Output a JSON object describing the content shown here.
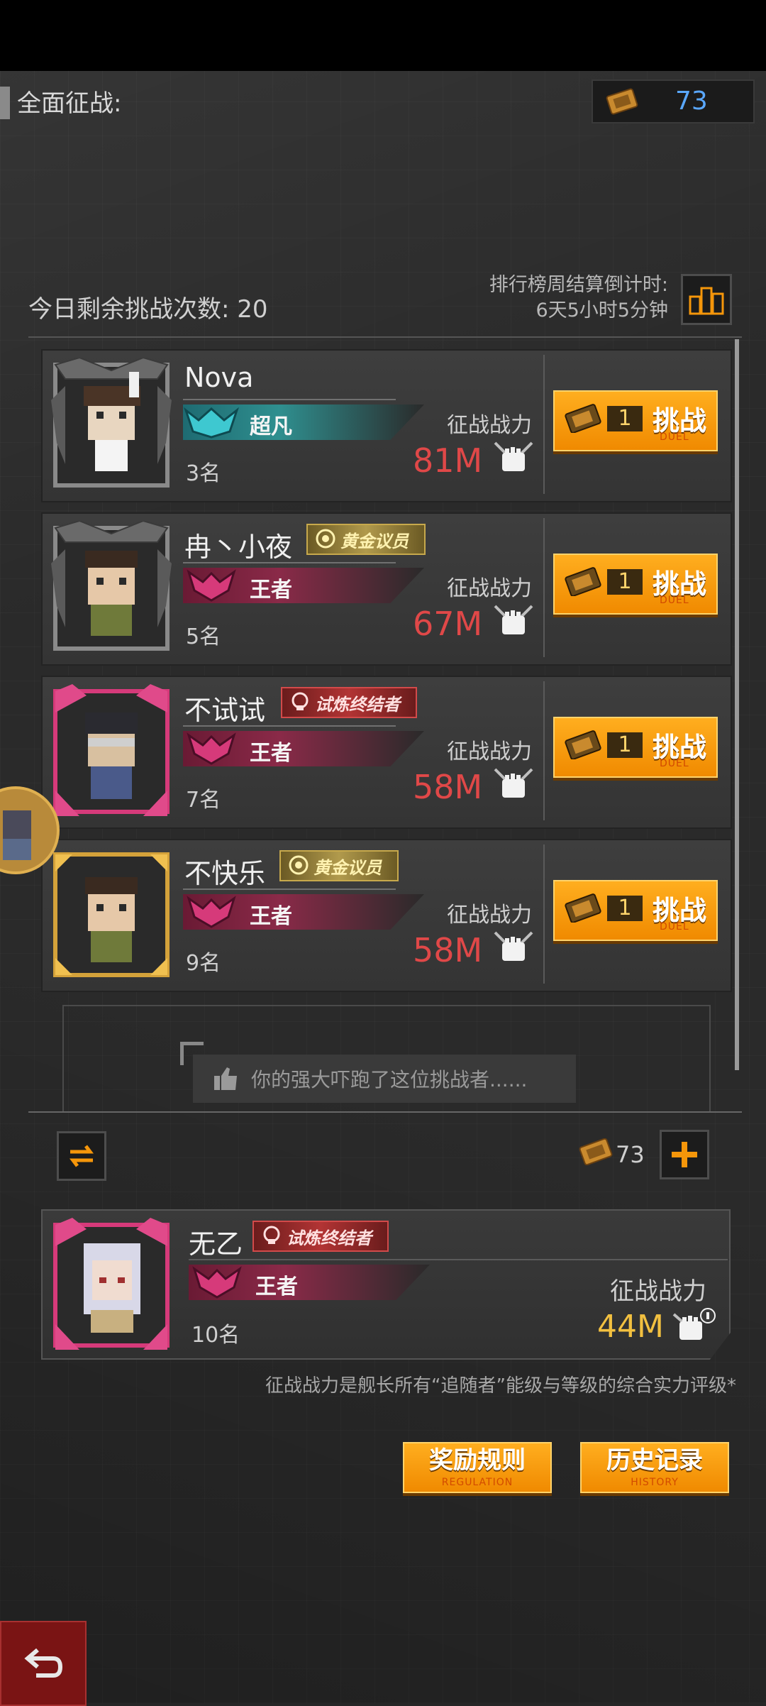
{
  "header": {
    "title": "全面征战:",
    "ticket_count": "73"
  },
  "info": {
    "remaining_label": "今日剩余挑战次数: 20",
    "countdown_label": "排行榜周结算倒计时:",
    "countdown_value": "6天5小时5分钟"
  },
  "opponents": [
    {
      "name": "Nova",
      "title": "",
      "tier": "超凡",
      "rank": "3名",
      "power_label": "征战战力",
      "power": "81M",
      "cost": "1",
      "button": "挑战",
      "button_sub": "DUEL"
    },
    {
      "name": "冉丶小夜",
      "title": "黄金议员",
      "tier": "王者",
      "rank": "5名",
      "power_label": "征战战力",
      "power": "67M",
      "cost": "1",
      "button": "挑战",
      "button_sub": "DUEL"
    },
    {
      "name": "不试试",
      "title": "试炼终结者",
      "tier": "王者",
      "rank": "7名",
      "power_label": "征战战力",
      "power": "58M",
      "cost": "1",
      "button": "挑战",
      "button_sub": "DUEL"
    },
    {
      "name": "不快乐",
      "title": "黄金议员",
      "tier": "王者",
      "rank": "9名",
      "power_label": "征战战力",
      "power": "58M",
      "cost": "1",
      "button": "挑战",
      "button_sub": "DUEL"
    }
  ],
  "empty_slot": {
    "message": "你的强大吓跑了这位挑战者......"
  },
  "footer": {
    "ticket_count": "73"
  },
  "me": {
    "name": "无乙",
    "title": "试炼终结者",
    "tier": "王者",
    "rank": "10名",
    "power_label": "征战战力",
    "power": "44M"
  },
  "note": "征战战力是舰长所有“追随者”能级与等级的综合实力评级*",
  "buttons": {
    "rewards": "奖励规则",
    "rewards_sub": "REGULATION",
    "history": "历史记录",
    "history_sub": "HISTORY"
  },
  "colors": {
    "accent_orange": "#f5960a",
    "power_red": "#e04848",
    "power_gold": "#f2c040",
    "ticket_blue": "#5aa8ff"
  },
  "icons": [
    "ticket-icon",
    "leaderboard-icon",
    "fist-icon",
    "tier-emblem-icon",
    "refresh-icon",
    "plus-icon",
    "thumbs-up-icon",
    "back-icon"
  ]
}
